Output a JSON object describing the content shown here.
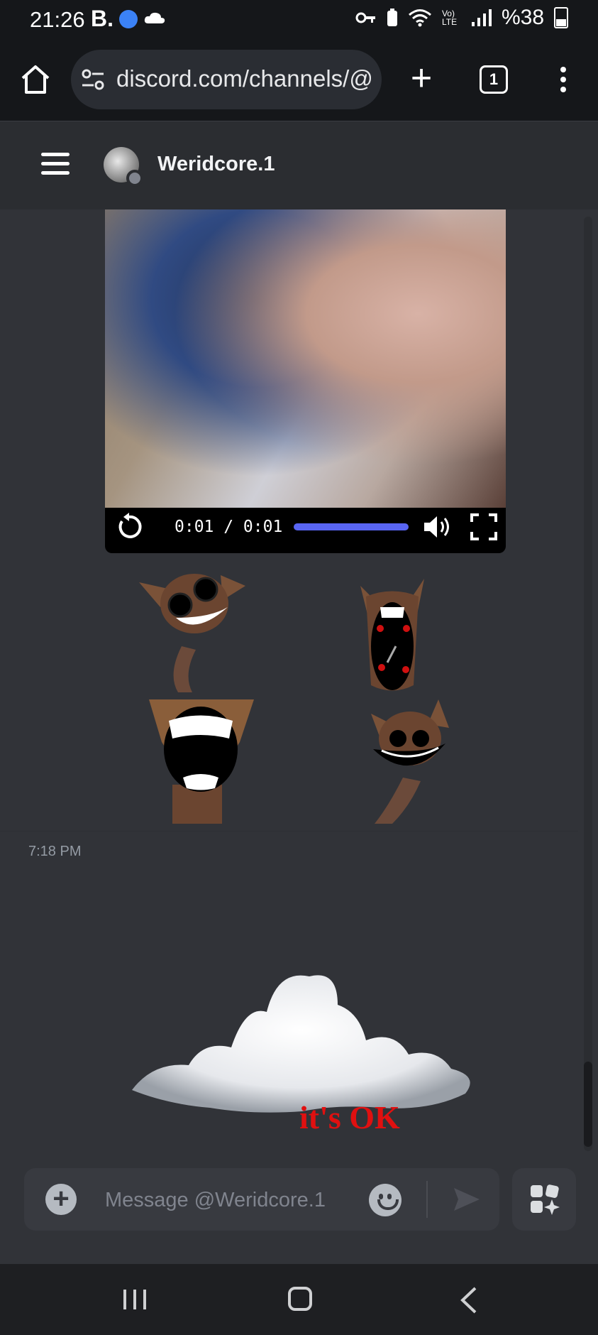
{
  "status_bar": {
    "time": "21:26",
    "brand_letter": "B.",
    "battery_text": "%38",
    "network_label": "Vo) LTE"
  },
  "browser": {
    "url": "discord.com/channels/@",
    "tab_count": "1"
  },
  "dm_header": {
    "username": "Weridcore.1"
  },
  "video": {
    "time_display": "0:01 / 0:01",
    "progress": 1.0
  },
  "stickers": [
    {
      "name": "cat-sticker-1"
    },
    {
      "name": "cat-sticker-2"
    },
    {
      "name": "cat-sticker-3"
    },
    {
      "name": "cat-sticker-4"
    }
  ],
  "message": {
    "timestamp": "7:18 PM",
    "image_caption": "it's OK"
  },
  "composer": {
    "placeholder": "Message @Weridcore.1"
  },
  "colors": {
    "accent": "#5865f2",
    "background": "#313338",
    "caption_red": "#e01010"
  },
  "icons": {
    "home": "home-icon",
    "site_settings": "tune-icon",
    "new_tab": "plus-icon",
    "menu": "more-vert-icon",
    "hamburger": "menu-icon",
    "replay": "replay-icon",
    "volume": "volume-icon",
    "fullscreen": "fullscreen-icon",
    "add": "add-circle-icon",
    "emoji": "emoji-icon",
    "send": "send-icon",
    "apps": "apps-icon"
  }
}
